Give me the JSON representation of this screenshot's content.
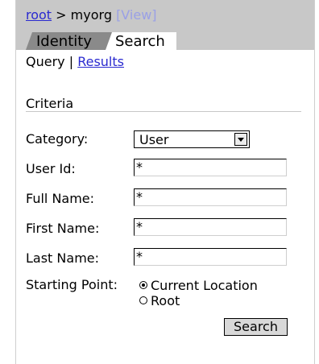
{
  "breadcrumb": {
    "root": "root",
    "separator": ">",
    "current": "myorg",
    "view": "[View]"
  },
  "tabs": [
    {
      "label": "Identity"
    },
    {
      "label": "Search"
    }
  ],
  "subnav": {
    "query": "Query",
    "divider": "|",
    "results": "Results"
  },
  "section": {
    "title": "Criteria"
  },
  "fields": {
    "category": {
      "label": "Category:",
      "value": "User"
    },
    "user_id": {
      "label": "User Id:",
      "value": "*"
    },
    "full_name": {
      "label": "Full Name:",
      "value": "*"
    },
    "first_name": {
      "label": "First Name:",
      "value": "*"
    },
    "last_name": {
      "label": "Last Name:",
      "value": "*"
    }
  },
  "starting_point": {
    "label": "Starting Point:",
    "options": [
      {
        "label": "Current Location",
        "selected": true
      },
      {
        "label": "Root",
        "selected": false
      }
    ]
  },
  "actions": {
    "search": "Search"
  },
  "colors": {
    "header_bg": "#c8c8c8",
    "tab_inactive": "#8a8a8a",
    "link": "#2a2ad0"
  }
}
